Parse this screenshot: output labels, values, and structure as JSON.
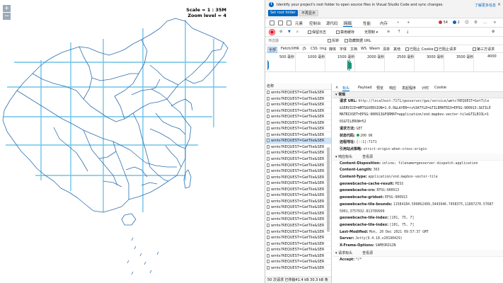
{
  "map": {
    "zoom_in": "+",
    "zoom_out": "−",
    "scale_text": "Scale = 1 : 35M",
    "zoom_level_text": "Zoom level = 4"
  },
  "devtools": {
    "infobar": {
      "message": "Identify your project's root folder to open source files in Visual Studio Code and sync changes.",
      "learn_more": "了解更多信息",
      "set_root_button": "Set root folder",
      "dont_show_button": "不再显示"
    },
    "tabs": [
      "元素",
      "控制台",
      "源代码",
      "网络",
      "性能",
      "内存"
    ],
    "active_tab": "网络",
    "errors_count": "54",
    "warnings_count": "2",
    "toolbar": {
      "preserve_log": "保留日志",
      "disable_cache": "禁用缓存",
      "throttling": "无限制"
    },
    "filter": {
      "placeholder": "筛选器",
      "invert": "反转",
      "hide_data_urls": "隐藏数据 URL"
    },
    "types": [
      "全部",
      "Fetch/XHR",
      "JS",
      "CSS",
      "Img",
      "媒体",
      "字体",
      "文档",
      "WS",
      "Wasm",
      "清单",
      "其他",
      "已阻止 Cookie",
      "已阻止请求",
      "第三方请求"
    ],
    "timeline_ticks": [
      "500 毫秒",
      "1000 毫秒",
      "1500 毫秒",
      "2000 毫秒",
      "2500 毫秒",
      "3000 毫秒",
      "3500 毫秒",
      "4000"
    ],
    "request_list": {
      "header": "名称",
      "row_name": "wmts?REQUEST=GetTile&SER",
      "status_text": "50 次请求   已传输41.4 kB   30.3 kB 条"
    },
    "details_tabs": [
      "标头",
      "Payload",
      "预览",
      "响应",
      "发起程序",
      "计时",
      "Cookie"
    ],
    "general": {
      "title": "▾ 常规",
      "request_url_label": "请求 URL:",
      "request_url_1": "http://localhost:7171/geoserver/gwc/service/wmts?REQUEST=GetTile",
      "request_url_2": "&SERVICE=WMTS&VERSION=1.0.0&LAYER=rv%3ATYLE=&TILEMATRIX=EPSG:900913:3&TILE",
      "request_url_3": "MATRIXSET=EPSG:900913&FORMAT=application/vnd.mapbox-vector-tile&TILECOL=1",
      "request_url_4": "01&TILEROW=52",
      "method_label": "请求方法:",
      "method": "GET",
      "status_label": "状态代码:",
      "status": "200 OK",
      "remote_label": "远程地址:",
      "remote": "[::1]:7171",
      "referrer_label": "引用站点策略:",
      "referrer": "strict-origin-when-cross-origin"
    },
    "response_headers": {
      "title": "▾ 响应标头",
      "view_source": "查看源",
      "items": [
        {
          "k": "Content-Disposition:",
          "v": "inline; filename=geoserver-dispatch.application"
        },
        {
          "k": "Content-Length:",
          "v": "363"
        },
        {
          "k": "Content-Type:",
          "v": "application/vnd.mapbox-vector-tile"
        },
        {
          "k": "geowebcache-cache-result:",
          "v": "MISS"
        },
        {
          "k": "geowebcache-crs:",
          "v": "EPSG:900913"
        },
        {
          "k": "geowebcache-gridset:",
          "v": "EPSG:900913"
        },
        {
          "k": "geowebcache-tile-bounds:",
          "v": "11584184.509062499,3443946.7458375,11897270.57687"
        },
        {
          "k": "",
          "v": "5001,3757032.813789999"
        },
        {
          "k": "geowebcache-tile-index:",
          "v": "[101, 75, 7]"
        },
        {
          "k": "geowebcache-tile-index:",
          "v": "[101, 75, 7]"
        },
        {
          "k": "Last-Modified:",
          "v": "Mon, 20 Dec 2021 09:57:37 GMT"
        },
        {
          "k": "Server:",
          "v": "Jetty(9.4.18.v20190429)"
        },
        {
          "k": "X-Frame-Options:",
          "v": "SAMEORIGIN"
        }
      ]
    },
    "request_headers": {
      "title": "▾ 请求标头",
      "view_source": "查看源",
      "accept_label": "Accept:",
      "accept": "*/*"
    }
  }
}
